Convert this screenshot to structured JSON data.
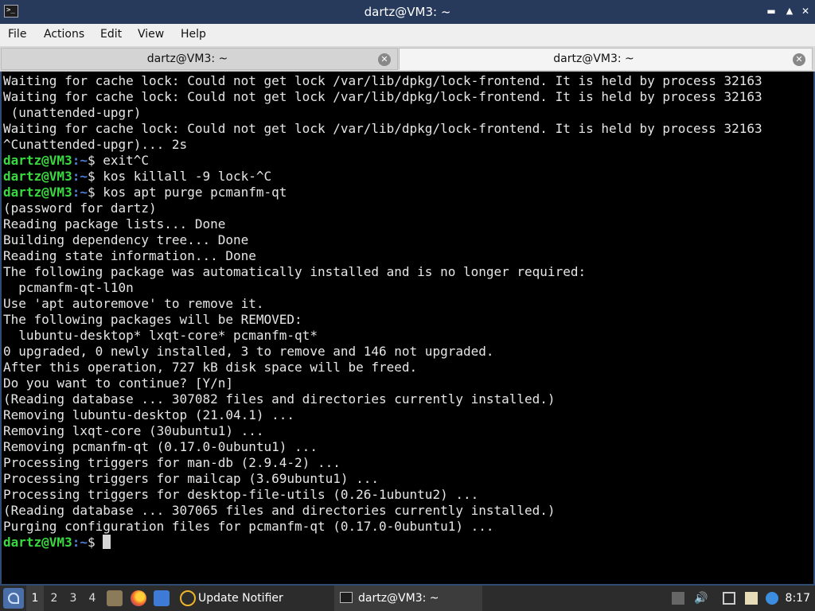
{
  "window": {
    "title": "dartz@VM3: ~"
  },
  "menu": [
    "File",
    "Actions",
    "Edit",
    "View",
    "Help"
  ],
  "tabs": [
    {
      "label": "dartz@VM3: ~",
      "active": false
    },
    {
      "label": "dartz@VM3: ~",
      "active": true
    }
  ],
  "terminal": {
    "prompt_user": "dartz@VM3",
    "prompt_path": ":~",
    "prompt_symbol": "$ ",
    "lines": [
      {
        "text": "Waiting for cache lock: Could not get lock /var/lib/dpkg/lock-frontend. It is held by process 32163"
      },
      {
        "text": "Waiting for cache lock: Could not get lock /var/lib/dpkg/lock-frontend. It is held by process 32163"
      },
      {
        "text": " (unattended-upgr)"
      },
      {
        "text": "Waiting for cache lock: Could not get lock /var/lib/dpkg/lock-frontend. It is held by process 32163"
      },
      {
        "text": "^Cunattended-upgr)... 2s"
      },
      {
        "prompt": true,
        "text": "exit^C"
      },
      {
        "prompt": true,
        "text": "kos killall -9 lock-^C"
      },
      {
        "prompt": true,
        "text": "kos apt purge pcmanfm-qt"
      },
      {
        "text": "(password for dartz)"
      },
      {
        "text": "Reading package lists... Done"
      },
      {
        "text": "Building dependency tree... Done"
      },
      {
        "text": "Reading state information... Done"
      },
      {
        "text": "The following package was automatically installed and is no longer required:"
      },
      {
        "text": "  pcmanfm-qt-l10n"
      },
      {
        "text": "Use 'apt autoremove' to remove it."
      },
      {
        "text": "The following packages will be REMOVED:"
      },
      {
        "text": "  lubuntu-desktop* lxqt-core* pcmanfm-qt*"
      },
      {
        "text": "0 upgraded, 0 newly installed, 3 to remove and 146 not upgraded."
      },
      {
        "text": "After this operation, 727 kB disk space will be freed."
      },
      {
        "text": "Do you want to continue? [Y/n]"
      },
      {
        "text": "(Reading database ... 307082 files and directories currently installed.)"
      },
      {
        "text": "Removing lubuntu-desktop (21.04.1) ..."
      },
      {
        "text": "Removing lxqt-core (30ubuntu1) ..."
      },
      {
        "text": "Removing pcmanfm-qt (0.17.0-0ubuntu1) ..."
      },
      {
        "text": "Processing triggers for man-db (2.9.4-2) ..."
      },
      {
        "text": "Processing triggers for mailcap (3.69ubuntu1) ..."
      },
      {
        "text": "Processing triggers for desktop-file-utils (0.26-1ubuntu2) ..."
      },
      {
        "text": "(Reading database ... 307065 files and directories currently installed.)"
      },
      {
        "text": "Purging configuration files for pcmanfm-qt (0.17.0-0ubuntu1) ..."
      },
      {
        "prompt": true,
        "text": "",
        "cursor": true
      }
    ]
  },
  "taskbar": {
    "workspaces": [
      "1",
      "2",
      "3",
      "4"
    ],
    "current_workspace": "1",
    "launchers": [
      "file-manager-icon",
      "firefox-icon",
      "desktop-icon"
    ],
    "tasks": [
      {
        "label": "Update Notifier",
        "icon": "update-notifier-icon"
      },
      {
        "label": "dartz@VM3: ~",
        "icon": "terminal-icon"
      }
    ],
    "tray": [
      "eject-icon",
      "volume-icon",
      "network-icon",
      "clipboard-icon",
      "update-icon"
    ],
    "clock": "8:17"
  },
  "colors": {
    "titlebar": "#283a5c",
    "prompt_user": "#39d93f",
    "prompt_path": "#4f7fd8",
    "terminal_bg": "#000000",
    "terminal_fg": "#e6e6e6",
    "taskbar": "#2c2c2c"
  }
}
